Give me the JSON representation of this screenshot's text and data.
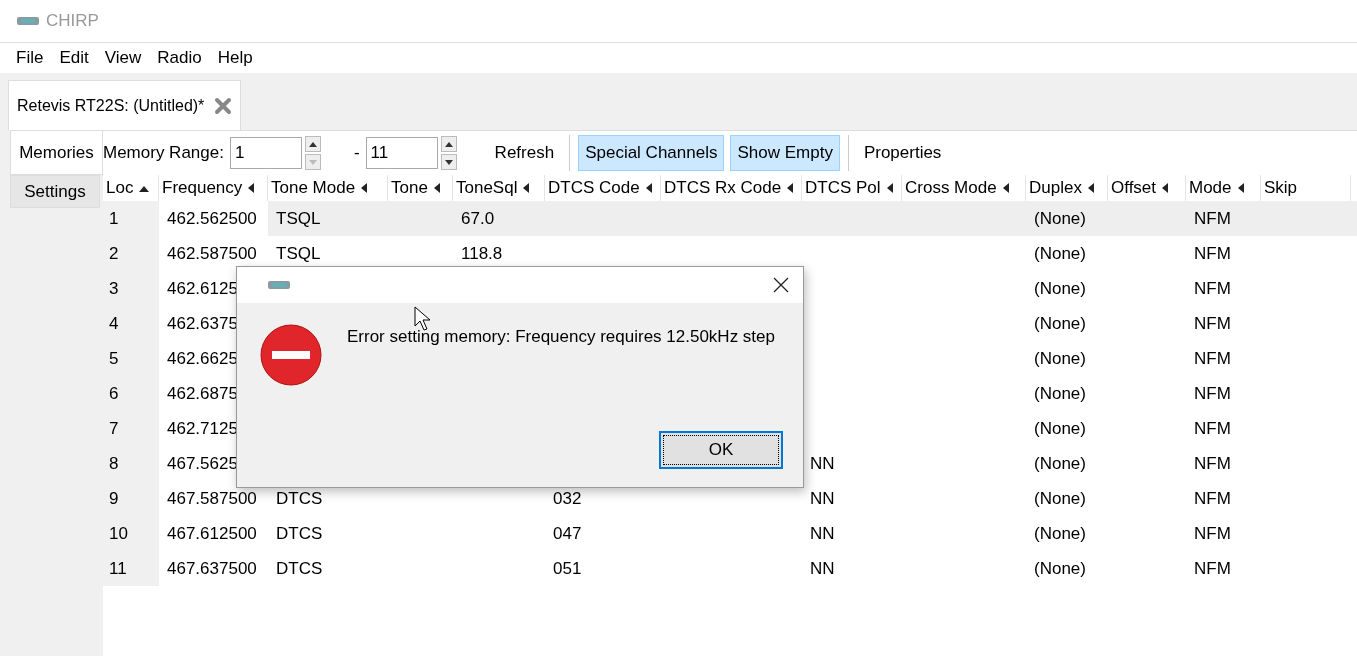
{
  "window": {
    "title": "CHIRP"
  },
  "menu": [
    "File",
    "Edit",
    "View",
    "Radio",
    "Help"
  ],
  "tabs": [
    {
      "label": "Retevis RT22S: (Untitled)*",
      "selected": true
    }
  ],
  "side_tabs": [
    {
      "label": "Memories",
      "selected": true
    },
    {
      "label": "Settings",
      "selected": false
    }
  ],
  "toolbar": {
    "range_label": "Memory Range:",
    "range_start": {
      "value": "1",
      "down_enabled": false
    },
    "separator": "-",
    "range_end": {
      "value": "11",
      "down_enabled": true
    },
    "buttons": [
      {
        "label": "Refresh",
        "pressed": false
      },
      {
        "label": "Special Channels",
        "pressed": true
      },
      {
        "label": "Show Empty",
        "pressed": true
      },
      {
        "label": "Properties",
        "pressed": false
      }
    ]
  },
  "table": {
    "columns": [
      {
        "label": "Loc",
        "sorted": true,
        "arrow": true
      },
      {
        "label": "Frequency",
        "sorted": false,
        "arrow": true
      },
      {
        "label": "Tone Mode",
        "sorted": false,
        "arrow": true
      },
      {
        "label": "Tone",
        "sorted": false,
        "arrow": true
      },
      {
        "label": "ToneSql",
        "sorted": false,
        "arrow": true
      },
      {
        "label": "DTCS Code",
        "sorted": false,
        "arrow": true
      },
      {
        "label": "DTCS Rx Code",
        "sorted": false,
        "arrow": true
      },
      {
        "label": "DTCS Pol",
        "sorted": false,
        "arrow": true
      },
      {
        "label": "Cross Mode",
        "sorted": false,
        "arrow": true
      },
      {
        "label": "Duplex",
        "sorted": false,
        "arrow": true
      },
      {
        "label": "Offset",
        "sorted": false,
        "arrow": true
      },
      {
        "label": "Mode",
        "sorted": false,
        "arrow": true
      },
      {
        "label": "Skip",
        "sorted": false,
        "arrow": false
      }
    ],
    "rows": [
      {
        "loc": "1",
        "frequency": "462.562500",
        "tone_mode": "TSQL",
        "tone_sql": "67.0",
        "duplex": "(None)",
        "mode": "NFM",
        "selected": true
      },
      {
        "loc": "2",
        "frequency": "462.587500",
        "tone_mode": "TSQL",
        "tone_sql": "118.8",
        "duplex": "(None)",
        "mode": "NFM",
        "selected": false
      },
      {
        "loc": "3",
        "frequency": "462.6125",
        "duplex": "(None)",
        "mode": "NFM",
        "selected": false
      },
      {
        "loc": "4",
        "frequency": "462.6375",
        "duplex": "(None)",
        "mode": "NFM",
        "selected": false
      },
      {
        "loc": "5",
        "frequency": "462.6625",
        "duplex": "(None)",
        "mode": "NFM",
        "selected": false
      },
      {
        "loc": "6",
        "frequency": "462.6875",
        "duplex": "(None)",
        "mode": "NFM",
        "selected": false
      },
      {
        "loc": "7",
        "frequency": "462.7125",
        "duplex": "(None)",
        "mode": "NFM",
        "selected": false
      },
      {
        "loc": "8",
        "frequency": "467.5625",
        "dtcs_pol": "NN",
        "duplex": "(None)",
        "mode": "NFM",
        "selected": false
      },
      {
        "loc": "9",
        "frequency": "467.587500",
        "tone_mode": "DTCS",
        "dtcs_code": "032",
        "dtcs_pol": "NN",
        "duplex": "(None)",
        "mode": "NFM",
        "selected": false
      },
      {
        "loc": "10",
        "frequency": "467.612500",
        "tone_mode": "DTCS",
        "dtcs_code": "047",
        "dtcs_pol": "NN",
        "duplex": "(None)",
        "mode": "NFM",
        "selected": false
      },
      {
        "loc": "11",
        "frequency": "467.637500",
        "tone_mode": "DTCS",
        "dtcs_code": "051",
        "dtcs_pol": "NN",
        "duplex": "(None)",
        "mode": "NFM",
        "selected": false
      }
    ]
  },
  "dialog": {
    "kind": "error",
    "message": "Error setting memory: Frequency requires 12.50kHz step",
    "button": "OK"
  }
}
